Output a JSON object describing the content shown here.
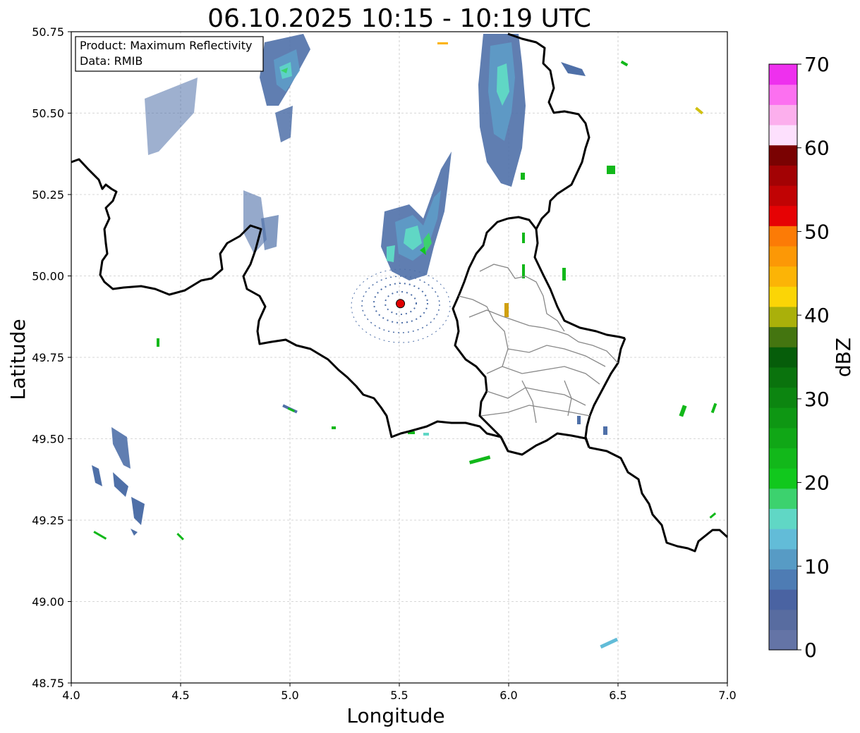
{
  "title": "06.10.2025 10:15 - 10:19 UTC",
  "info_box": {
    "line1": "Product: Maximum Reflectivity",
    "line2": "Data: RMIB"
  },
  "map": {
    "xlabel": "Longitude",
    "ylabel": "Latitude",
    "xlim": [
      4.0,
      7.0
    ],
    "ylim": [
      48.75,
      50.75
    ],
    "x_ticks": [
      "4.0",
      "4.5",
      "5.0",
      "5.5",
      "6.0",
      "6.5",
      "7.0"
    ],
    "y_ticks": [
      "48.75",
      "49.00",
      "49.25",
      "49.50",
      "49.75",
      "50.00",
      "50.25",
      "50.50",
      "50.75"
    ],
    "x_tick_values": [
      4.0,
      4.5,
      5.0,
      5.5,
      6.0,
      6.5,
      7.0
    ],
    "y_tick_values": [
      48.75,
      49.0,
      49.25,
      49.5,
      49.75,
      50.0,
      50.25,
      50.5,
      50.75
    ],
    "grid": true,
    "radar_site": {
      "lon": 5.505,
      "lat": 49.915,
      "color": "#e00000"
    }
  },
  "colorbar": {
    "label": "dBZ",
    "ticks": [
      "0",
      "10",
      "20",
      "30",
      "40",
      "50",
      "60",
      "70"
    ],
    "tick_values": [
      0,
      10,
      20,
      30,
      40,
      50,
      60,
      70
    ],
    "colors": [
      "#6474a6",
      "#586ca0",
      "#4a63a2",
      "#4e7cb4",
      "#579bc5",
      "#62bcd8",
      "#60d7c5",
      "#3cd26e",
      "#11c81d",
      "#12b81a",
      "#10a716",
      "#0e9713",
      "#0c8510",
      "#0a730d",
      "#065d0a",
      "#447510",
      "#aab00a",
      "#fbd506",
      "#fcb406",
      "#fc9806",
      "#fc7b06",
      "#e60204",
      "#c10304",
      "#a30204",
      "#7a0202",
      "#fde0fd",
      "#fcafed",
      "#fc70f0",
      "#ee30ee"
    ]
  },
  "echo_clusters": [
    {
      "lon": 5.1,
      "lat": 50.62,
      "intensity": 12
    },
    {
      "lon": 5.55,
      "lat": 50.1,
      "intensity": 15
    },
    {
      "lon": 6.0,
      "lat": 50.55,
      "intensity": 12
    },
    {
      "lon": 4.35,
      "lat": 50.45,
      "intensity": 6
    },
    {
      "lon": 4.22,
      "lat": 49.35,
      "intensity": 6
    }
  ]
}
